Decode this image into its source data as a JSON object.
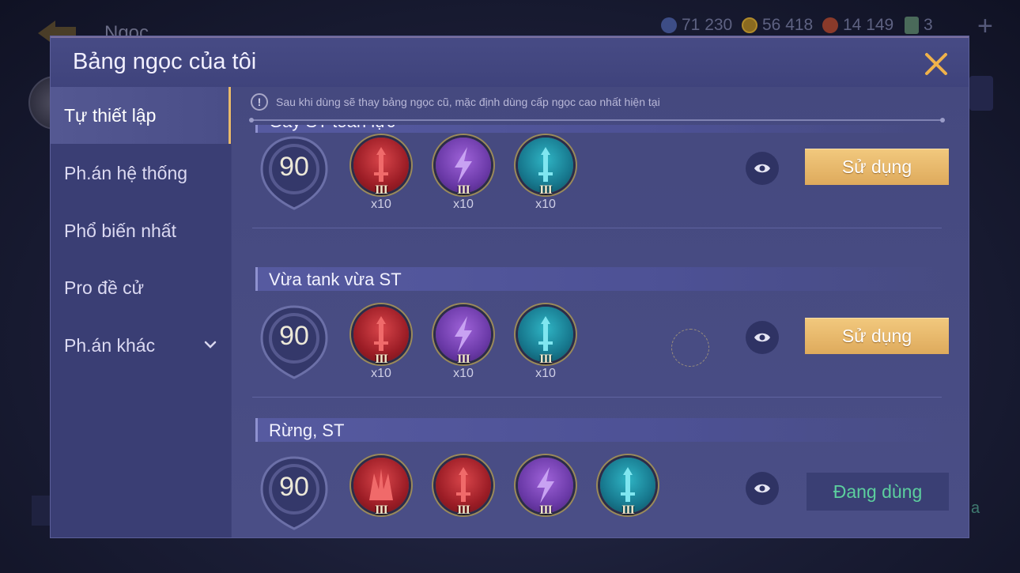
{
  "background": {
    "title": "Ngọc",
    "currencies": [
      {
        "icon": "gem-icon",
        "value": "71 230"
      },
      {
        "icon": "gold-coin-icon",
        "value": "56 418"
      },
      {
        "icon": "red-crystal-icon",
        "value": "14 149"
      },
      {
        "icon": "card-icon",
        "value": "3"
      }
    ],
    "plus_label": "+",
    "right_fragment": "a"
  },
  "dialog": {
    "title": "Bảng ngọc của tôi",
    "close_icon": "close-icon",
    "sidebar": {
      "items": [
        {
          "label": "Tự thiết lập",
          "active": true
        },
        {
          "label": "Ph.án hệ thống",
          "active": false
        },
        {
          "label": "Phổ biến nhất",
          "active": false
        },
        {
          "label": "Pro đề cử",
          "active": false
        },
        {
          "label": "Ph.án khác",
          "active": false,
          "has_dropdown": true
        }
      ]
    },
    "notice": {
      "icon": "!",
      "text": "Sau khi dùng sẽ thay bảng ngọc cũ, mặc định dùng cấp ngọc cao nhất hiện tại"
    },
    "sets": [
      {
        "name": "Gây ST toàn lực",
        "level": "90",
        "gems": [
          {
            "color": "red",
            "icon": "sword-icon",
            "tier": "III",
            "count": "x10"
          },
          {
            "color": "purple",
            "icon": "lightning-icon",
            "tier": "III",
            "count": "x10"
          },
          {
            "color": "teal",
            "icon": "sword-icon",
            "tier": "III",
            "count": "x10"
          }
        ],
        "action_label": "Sử dụng",
        "in_use": false
      },
      {
        "name": "Vừa tank vừa ST",
        "level": "90",
        "gems": [
          {
            "color": "red",
            "icon": "sword-icon",
            "tier": "III",
            "count": "x10"
          },
          {
            "color": "purple",
            "icon": "lightning-icon",
            "tier": "III",
            "count": "x10"
          },
          {
            "color": "teal",
            "icon": "sword-icon",
            "tier": "III",
            "count": "x10"
          }
        ],
        "action_label": "Sử dụng",
        "in_use": false
      },
      {
        "name": "Rừng, ST",
        "level": "90",
        "gems": [
          {
            "color": "red",
            "icon": "claw-icon",
            "tier": "III",
            "count": ""
          },
          {
            "color": "red",
            "icon": "sword-icon",
            "tier": "III",
            "count": ""
          },
          {
            "color": "purple",
            "icon": "lightning-icon",
            "tier": "III",
            "count": ""
          },
          {
            "color": "teal",
            "icon": "sword-icon",
            "tier": "III",
            "count": ""
          }
        ],
        "action_label": "Đang dùng",
        "in_use": true
      }
    ],
    "colors": {
      "accent_gold": "#deaa5c",
      "in_use_green": "#5ccf9e",
      "panel": "#3e4279"
    }
  }
}
